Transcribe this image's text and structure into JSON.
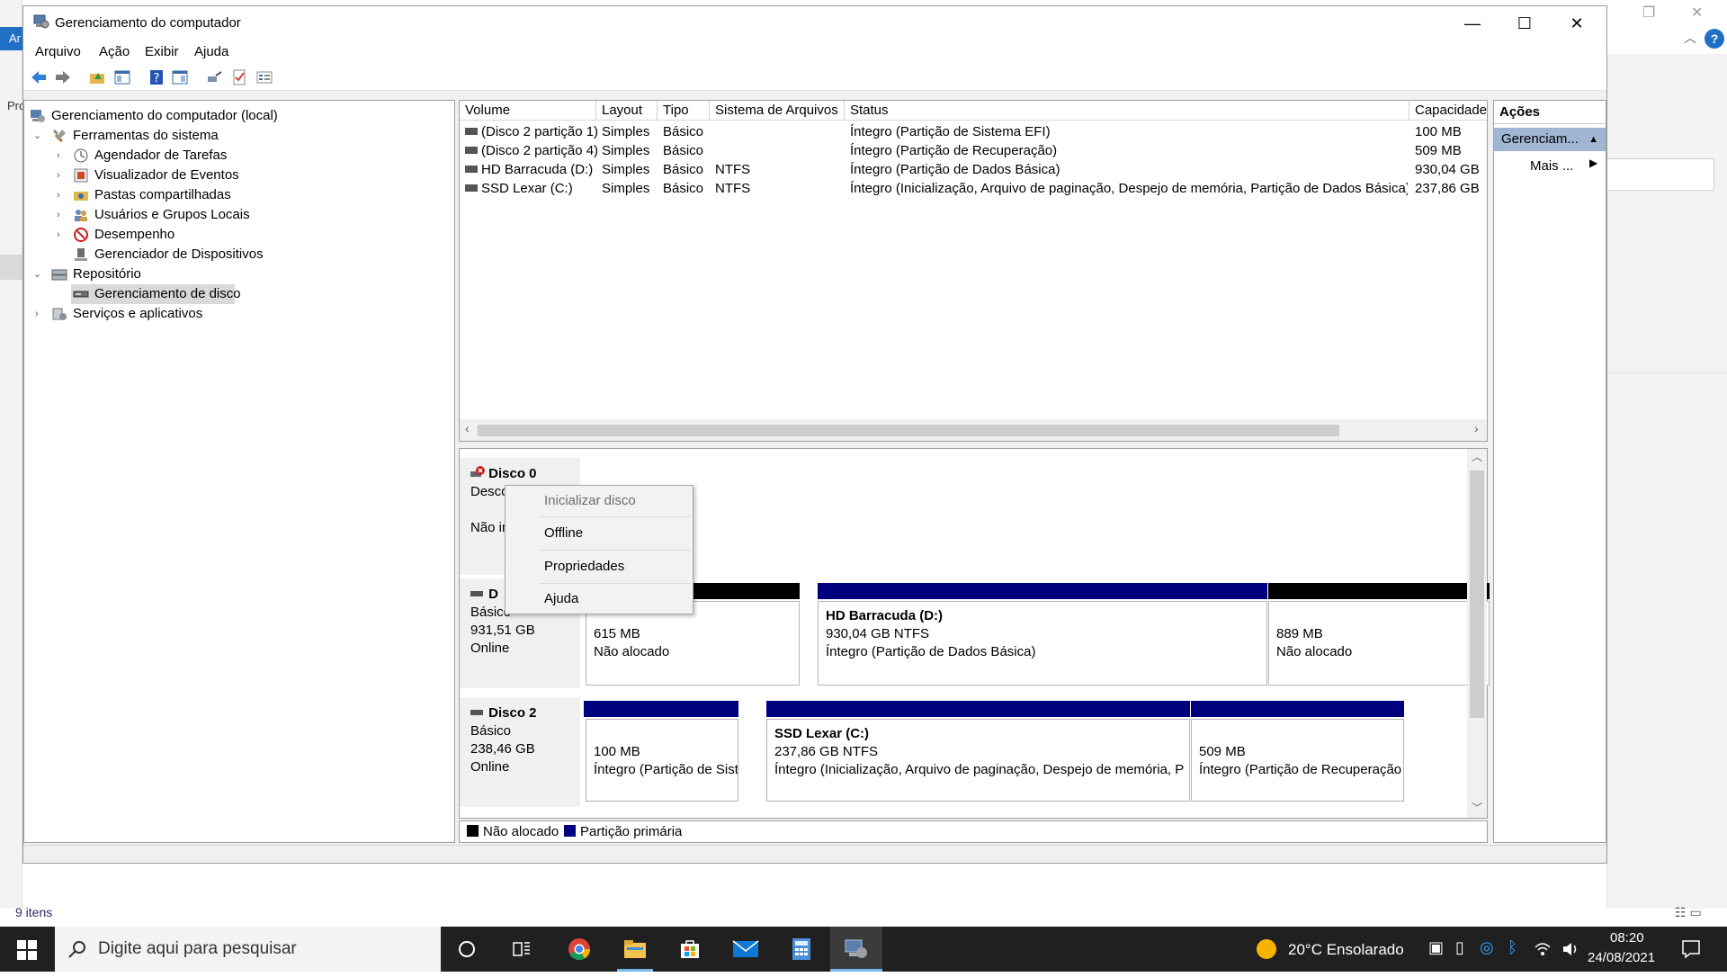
{
  "window": {
    "title": "Gerenciamento do computador",
    "minimize": "—",
    "maximize": "☐",
    "close": "✕"
  },
  "menu": [
    "Arquivo",
    "Ação",
    "Exibir",
    "Ajuda"
  ],
  "tree": {
    "root": "Gerenciamento do computador (local)",
    "system_tools": "Ferramentas do sistema",
    "task_scheduler": "Agendador de Tarefas",
    "event_viewer": "Visualizador de Eventos",
    "shared_folders": "Pastas compartilhadas",
    "local_users": "Usuários e Grupos Locais",
    "performance": "Desempenho",
    "device_manager": "Gerenciador de Dispositivos",
    "storage": "Repositório",
    "disk_management": "Gerenciamento de disco",
    "services": "Serviços e aplicativos"
  },
  "volumes": {
    "headers": [
      "Volume",
      "Layout",
      "Tipo",
      "Sistema de Arquivos",
      "Status",
      "Capacidade"
    ],
    "rows": [
      [
        "(Disco 2 partição 1)",
        "Simples",
        "Básico",
        "",
        "Íntegro (Partição de Sistema EFI)",
        "100 MB"
      ],
      [
        "(Disco 2 partição 4)",
        "Simples",
        "Básico",
        "",
        "Íntegro (Partição de Recuperação)",
        "509 MB"
      ],
      [
        "HD Barracuda (D:)",
        "Simples",
        "Básico",
        "NTFS",
        "Íntegro (Partição de Dados Básica)",
        "930,04 GB"
      ],
      [
        "SSD Lexar (C:)",
        "Simples",
        "Básico",
        "NTFS",
        "Íntegro (Inicialização, Arquivo de paginação, Despejo de memória, Partição de Dados Básica)",
        "237,86 GB"
      ]
    ]
  },
  "disks": {
    "disk0": {
      "name": "Disco 0",
      "line2": "Desco",
      "line3": "Não in"
    },
    "disk1": {
      "name": "D",
      "type": "Básico",
      "size": "931,51 GB",
      "state": "Online"
    },
    "disk2": {
      "name": "Disco 2",
      "type": "Básico",
      "size": "238,46 GB",
      "state": "Online"
    },
    "disk1_parts": [
      {
        "title": "",
        "line1": "615 MB",
        "line2": "Não alocado"
      },
      {
        "title": "HD Barracuda  (D:)",
        "line1": "930,04 GB NTFS",
        "line2": "Íntegro (Partição de Dados Básica)"
      },
      {
        "title": "",
        "line1": "889 MB",
        "line2": "Não alocado"
      }
    ],
    "disk2_parts": [
      {
        "title": "",
        "line1": "100 MB",
        "line2": "Íntegro (Partição de Sist"
      },
      {
        "title": "SSD Lexar  (C:)",
        "line1": "237,86 GB NTFS",
        "line2": "Íntegro (Inicialização, Arquivo de paginação, Despejo de memória, P"
      },
      {
        "title": "",
        "line1": "509 MB",
        "line2": "Íntegro (Partição de Recuperação"
      }
    ]
  },
  "legend": {
    "unallocated": "Não alocado",
    "primary": "Partição primária"
  },
  "actions": {
    "header": "Ações",
    "selected": "Gerenciam...",
    "more": "Mais ..."
  },
  "context_menu": [
    "Inicializar disco",
    "Offline",
    "Propriedades",
    "Ajuda"
  ],
  "background": {
    "left_tab": "Ar",
    "left_label": "Pro",
    "items_count": "9 itens"
  },
  "taskbar": {
    "search_placeholder": "Digite aqui para pesquisar",
    "weather": "20°C  Ensolarado",
    "time": "08:20",
    "date": "24/08/2021"
  },
  "colors": {
    "unallocated": "#000000",
    "primary": "#00007f",
    "action_selected": "#9fb5d2",
    "taskbar": "#202020"
  }
}
